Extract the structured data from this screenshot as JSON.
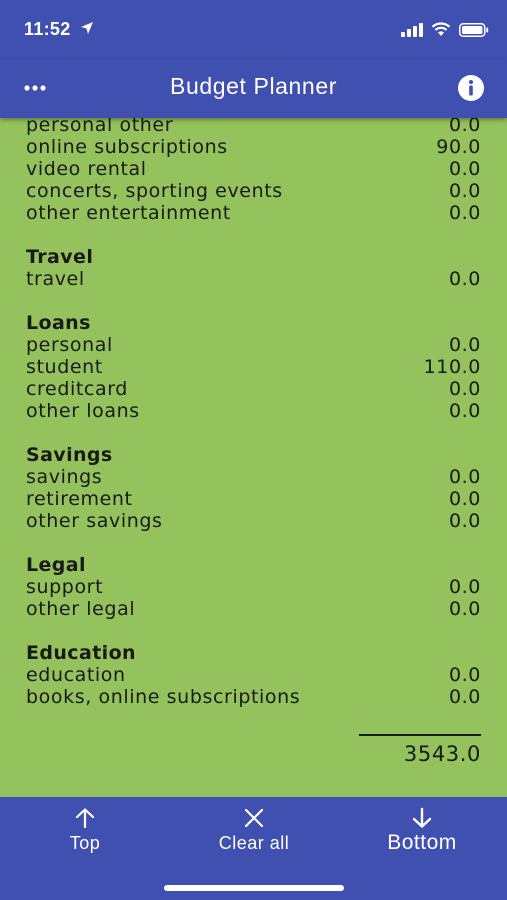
{
  "status_bar": {
    "time": "11:52"
  },
  "header": {
    "title": "Budget Planner"
  },
  "sections": [
    {
      "title": "",
      "items": [
        {
          "label": "personal other",
          "value": "0.0"
        },
        {
          "label": "online subscriptions",
          "value": "90.0"
        },
        {
          "label": "video rental",
          "value": "0.0"
        },
        {
          "label": "concerts, sporting events",
          "value": "0.0"
        },
        {
          "label": "other entertainment",
          "value": "0.0"
        }
      ]
    },
    {
      "title": "Travel",
      "items": [
        {
          "label": "travel",
          "value": "0.0"
        }
      ]
    },
    {
      "title": "Loans",
      "items": [
        {
          "label": "personal",
          "value": "0.0"
        },
        {
          "label": "student",
          "value": "110.0"
        },
        {
          "label": "creditcard",
          "value": "0.0"
        },
        {
          "label": "other loans",
          "value": "0.0"
        }
      ]
    },
    {
      "title": "Savings",
      "items": [
        {
          "label": "savings",
          "value": "0.0"
        },
        {
          "label": "retirement",
          "value": "0.0"
        },
        {
          "label": "other savings",
          "value": "0.0"
        }
      ]
    },
    {
      "title": "Legal",
      "items": [
        {
          "label": "support",
          "value": "0.0"
        },
        {
          "label": "other legal",
          "value": "0.0"
        }
      ]
    },
    {
      "title": "Education",
      "items": [
        {
          "label": "education",
          "value": "0.0"
        },
        {
          "label": "books, online subscriptions",
          "value": "0.0"
        }
      ]
    }
  ],
  "total": "3543.0",
  "bottom_nav": {
    "top_label": "Top",
    "clear_label": "Clear all",
    "bottom_label": "Bottom"
  },
  "icons": {
    "menu": "more-horizontal-icon",
    "info": "info-icon",
    "top": "arrow-up-icon",
    "clear": "close-icon",
    "bottom": "arrow-down-icon"
  },
  "colors": {
    "primary": "#4050b0",
    "background": "#94c25c",
    "text": "#1a1a1a"
  }
}
